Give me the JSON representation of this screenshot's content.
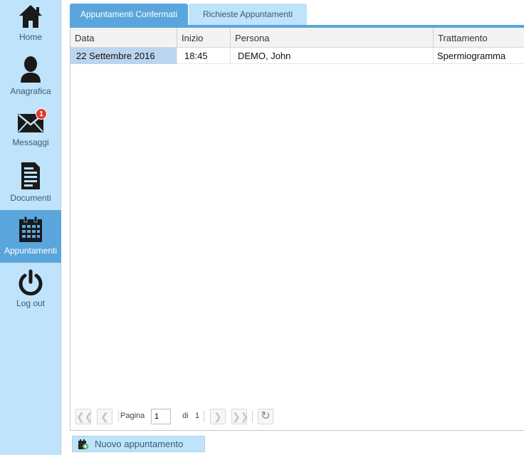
{
  "sidebar": {
    "items": [
      {
        "label": "Home",
        "icon": "home-icon"
      },
      {
        "label": "Anagrafica",
        "icon": "person-icon"
      },
      {
        "label": "Messaggi",
        "icon": "envelope-icon",
        "badge": "1"
      },
      {
        "label": "Documenti",
        "icon": "document-icon"
      },
      {
        "label": "Appuntamenti",
        "icon": "calendar-icon",
        "active": true
      },
      {
        "label": "Log out",
        "icon": "power-icon"
      }
    ]
  },
  "tabs": [
    {
      "label": "Appuntamenti Confermati",
      "active": true
    },
    {
      "label": "Richieste Appuntamenti",
      "active": false
    }
  ],
  "table": {
    "columns": [
      "Data",
      "Inizio",
      "Persona",
      "Trattamento"
    ],
    "rows": [
      {
        "data": "22 Settembre 2016",
        "inizio": "18:45",
        "persona": "DEMO, John",
        "trattamento": "Spermiogramma"
      }
    ]
  },
  "pager": {
    "page_label": "Pagina",
    "page_value": "1",
    "of_label": "di",
    "total_pages": "1"
  },
  "actions": {
    "new_label": "Nuovo appuntamento"
  },
  "colors": {
    "sidebar_bg": "#bfe3fa",
    "accent": "#5aa6dc",
    "badge": "#e8362e",
    "selected_cell": "#bcd5ef"
  }
}
